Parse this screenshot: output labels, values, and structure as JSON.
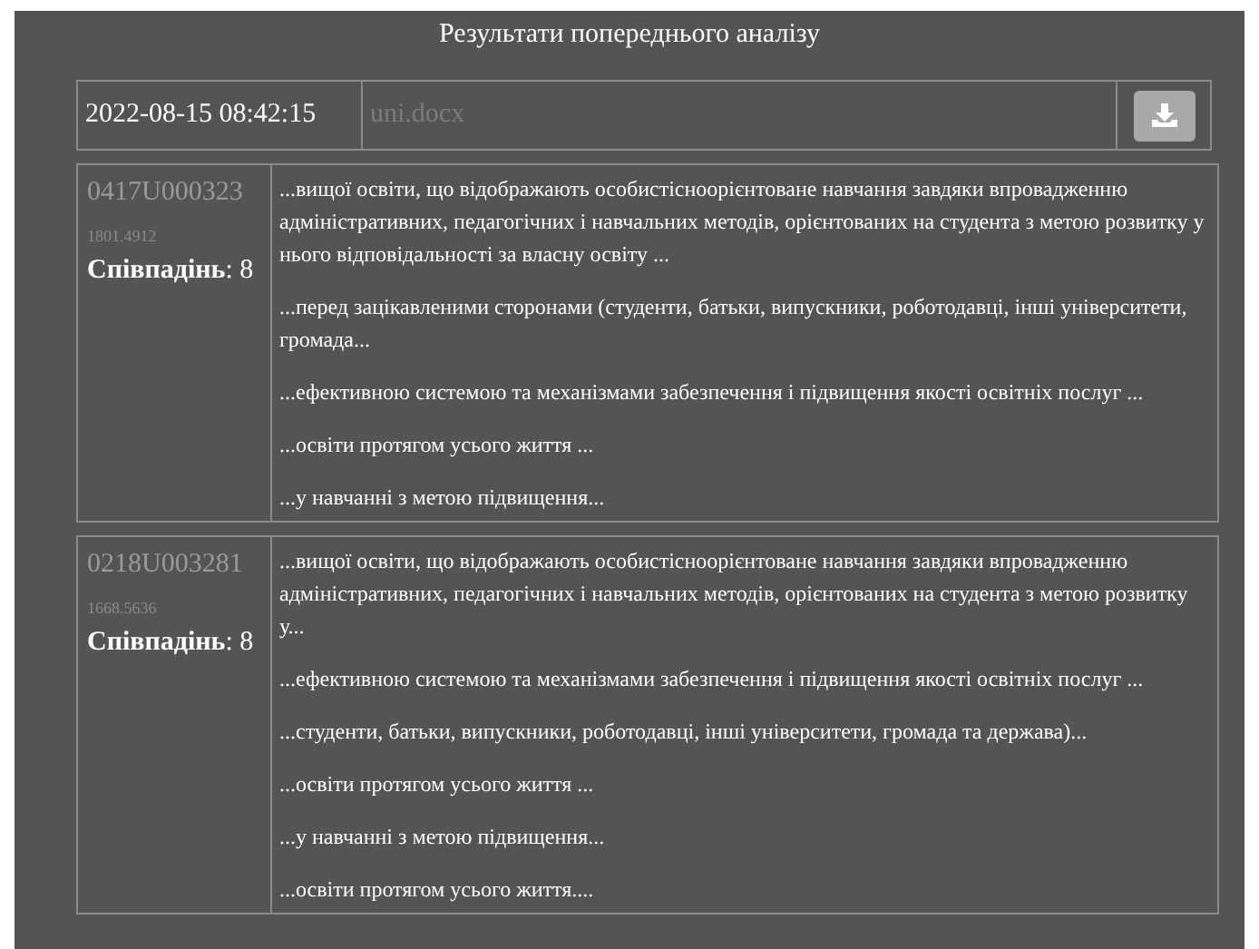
{
  "title": "Результати попереднього аналізу",
  "header": {
    "date": "2022-08-15 08:42:15",
    "file_name": "uni.docx"
  },
  "results": [
    {
      "code": "0417U000323",
      "score": "1801.4912",
      "matches": "**Співпадінь**: 8",
      "snippets": [
        "...вищої освіти, що відображають особистісноорієнтоване навчання завдяки впровадженню адміністративних, педагогічних і навчальних методів, орієнтованих на студента з метою розвитку у нього відповідальності за власну освіту ...",
        "...перед зацікавленими сторонами (студенти, батьки, випускники, роботодавці, інші університети, громада...",
        "...ефективною системою та механізмами забезпечення і підвищення якості освітніх послуг ...",
        "...освіти протягом усього життя ...",
        "...у навчанні з метою підвищення..."
      ]
    },
    {
      "code": "0218U003281",
      "score": "1668.5636",
      "matches": "**Співпадінь**: 8",
      "snippets": [
        "...вищої освіти, що відображають особистісноорієнтоване навчання завдяки впровадженню адміністративних, педагогічних і навчальних методів, орієнтованих на студента з метою розвитку у...",
        "...ефективною системою та механізмами забезпечення і підвищення якості освітніх послуг ...",
        "...студенти, батьки, випускники, роботодавці, інші університети, громада та держава)...",
        "...освіти протягом усього життя ...",
        "...у навчанні з метою підвищення...",
        "...освіти протягом усього життя...."
      ]
    }
  ]
}
